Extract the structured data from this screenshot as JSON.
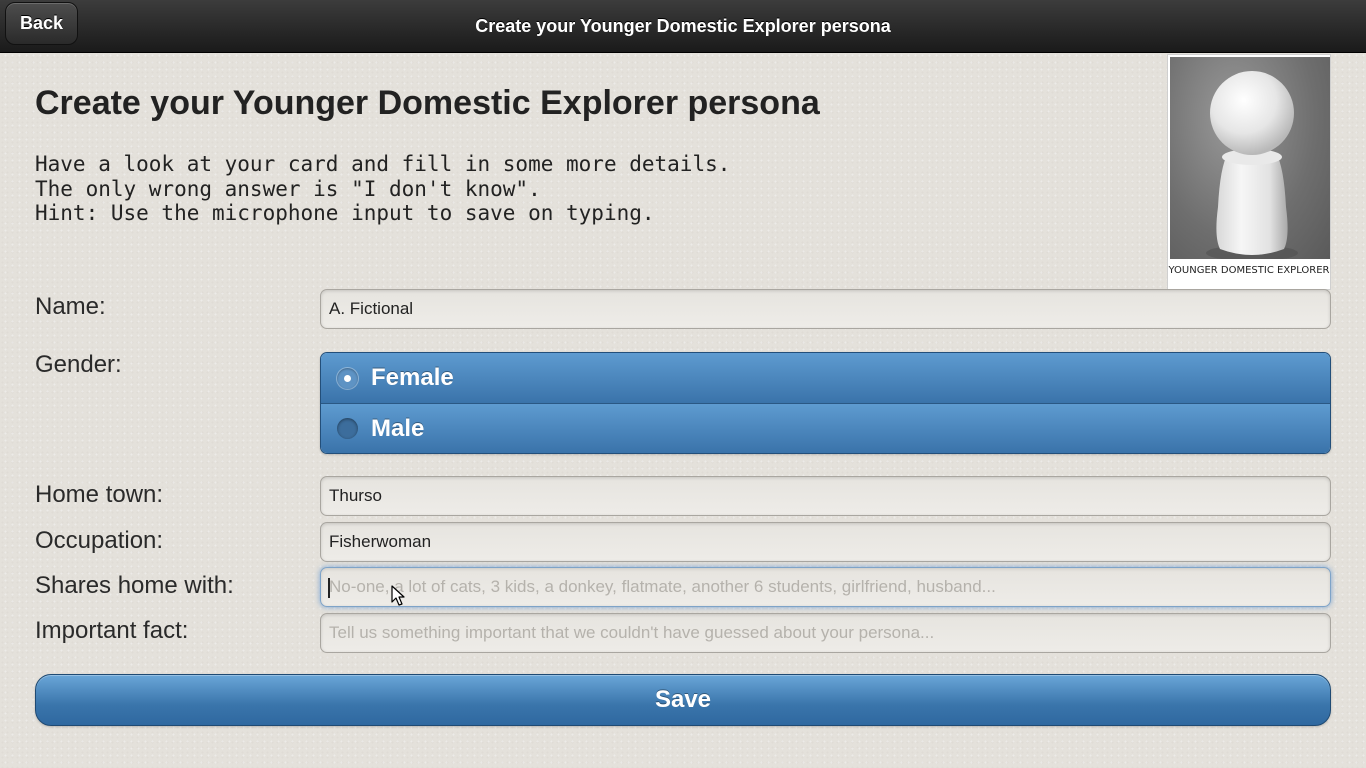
{
  "header": {
    "back_label": "Back",
    "title": "Create your Younger Domestic Explorer persona"
  },
  "main": {
    "heading": "Create your Younger Domestic Explorer persona",
    "intro_lines": [
      "Have a look at your card and fill in some more details.",
      "The only wrong answer is \"I don't know\".",
      "Hint: Use the microphone input to save on typing."
    ]
  },
  "card": {
    "caption": "YOUNGER DOMESTIC EXPLORER",
    "image": "white-pawn-figure"
  },
  "form": {
    "name": {
      "label": "Name:",
      "value": "A. Fictional",
      "placeholder": ""
    },
    "gender": {
      "label": "Gender:",
      "options": [
        "Female",
        "Male"
      ],
      "selected": "Female"
    },
    "home_town": {
      "label": "Home town:",
      "value": "Thurso",
      "placeholder": ""
    },
    "occupation": {
      "label": "Occupation:",
      "value": "Fisherwoman",
      "placeholder": ""
    },
    "shares_home": {
      "label": "Shares home with:",
      "value": "",
      "placeholder": "No-one, a lot of cats, 3 kids, a donkey, flatmate, another 6 students, girlfriend, husband..."
    },
    "important_fact": {
      "label": "Important fact:",
      "value": "",
      "placeholder": "Tell us something important that we couldn't have guessed about your persona..."
    },
    "save_label": "Save"
  },
  "colors": {
    "accent": "#3a75ab",
    "header": "#1a1a1a",
    "background": "#e4e1db"
  }
}
